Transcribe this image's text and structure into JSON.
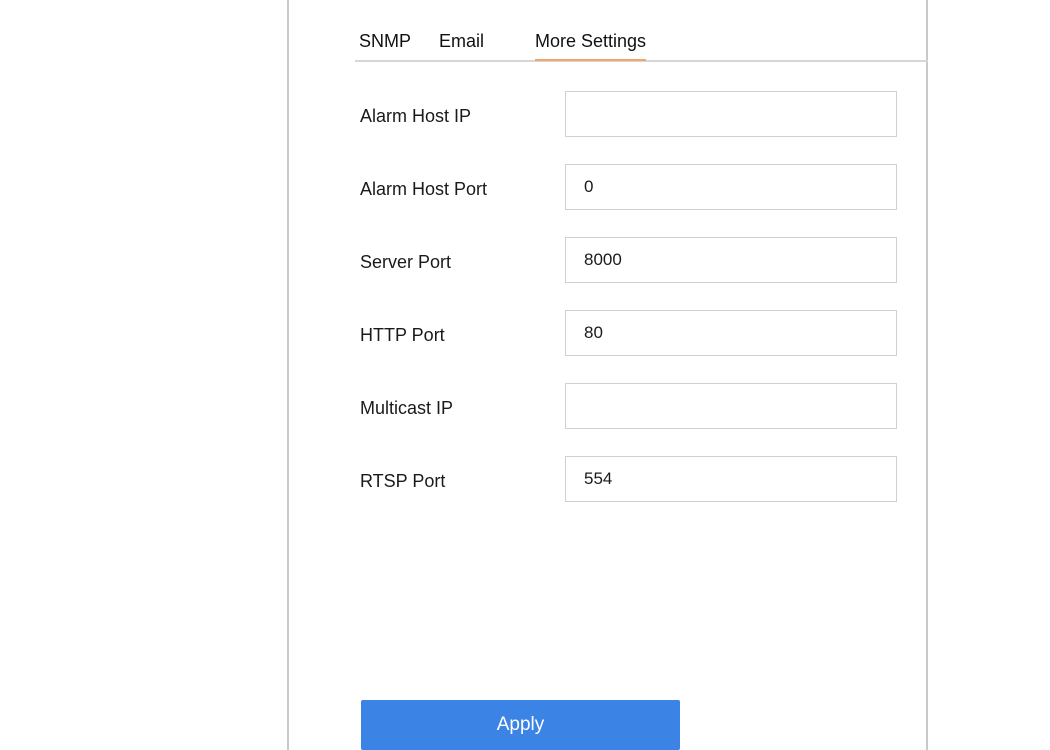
{
  "tabs": [
    {
      "label": "SNMP",
      "active": false
    },
    {
      "label": "Email",
      "active": false
    },
    {
      "label": "More Settings",
      "active": true
    }
  ],
  "fields": [
    {
      "label": "Alarm Host IP",
      "value": ""
    },
    {
      "label": "Alarm Host Port",
      "value": "0"
    },
    {
      "label": "Server Port",
      "value": "8000"
    },
    {
      "label": "HTTP Port",
      "value": "80"
    },
    {
      "label": "Multicast IP",
      "value": ""
    },
    {
      "label": "RTSP Port",
      "value": "554"
    }
  ],
  "actions": {
    "apply_label": "Apply"
  },
  "colors": {
    "accent_underline": "#f0a56b",
    "button_bg": "#3b84e6",
    "border": "#d0d0d0"
  }
}
